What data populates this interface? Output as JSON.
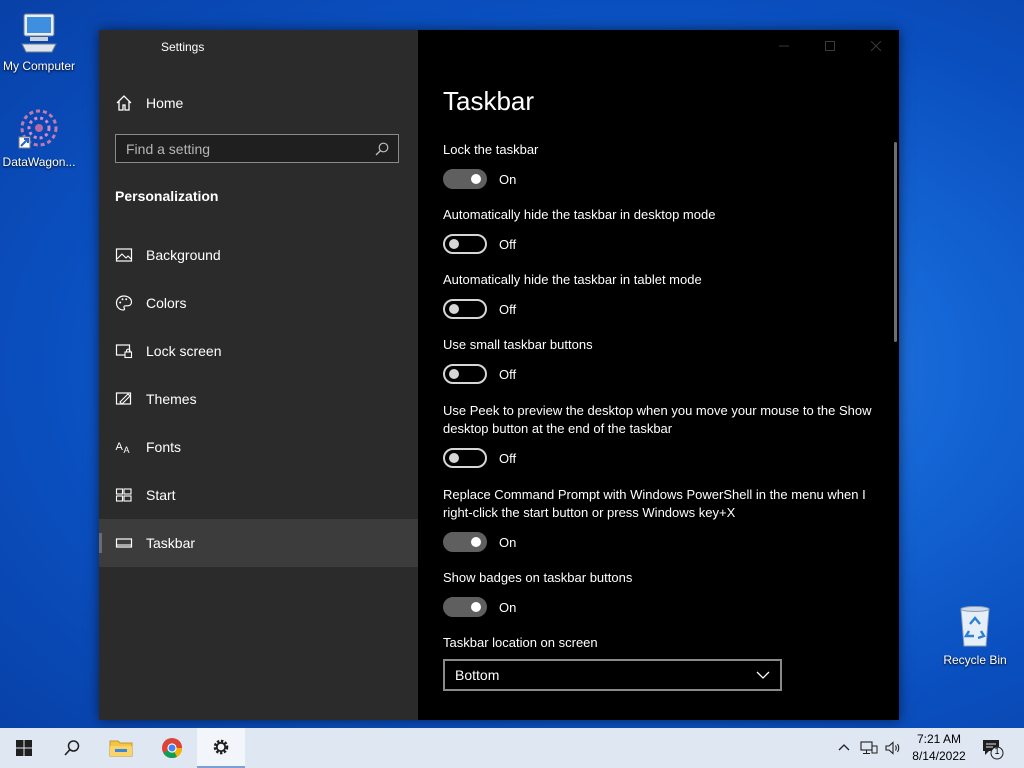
{
  "desktop": {
    "icons": [
      {
        "label": "My Computer",
        "icon": "computer-icon"
      },
      {
        "label": "DataWagon...",
        "icon": "datawagon-shortcut-icon"
      },
      {
        "label": "Recycle Bin",
        "icon": "recycle-bin-icon"
      }
    ]
  },
  "window": {
    "title": "Settings",
    "sidebar": {
      "home_label": "Home",
      "search_placeholder": "Find a setting",
      "section_heading": "Personalization",
      "items": [
        {
          "label": "Background",
          "icon": "picture-icon"
        },
        {
          "label": "Colors",
          "icon": "palette-icon"
        },
        {
          "label": "Lock screen",
          "icon": "lock-screen-icon"
        },
        {
          "label": "Themes",
          "icon": "themes-icon"
        },
        {
          "label": "Fonts",
          "icon": "fonts-icon"
        },
        {
          "label": "Start",
          "icon": "start-icon"
        },
        {
          "label": "Taskbar",
          "icon": "taskbar-icon",
          "selected": true
        }
      ]
    },
    "main": {
      "title": "Taskbar",
      "settings": [
        {
          "label": "Lock the taskbar",
          "state": "On",
          "on": true
        },
        {
          "label": "Automatically hide the taskbar in desktop mode",
          "state": "Off",
          "on": false
        },
        {
          "label": "Automatically hide the taskbar in tablet mode",
          "state": "Off",
          "on": false
        },
        {
          "label": "Use small taskbar buttons",
          "state": "Off",
          "on": false
        },
        {
          "label": "Use Peek to preview the desktop when you move your mouse to the Show desktop button at the end of the taskbar",
          "state": "Off",
          "on": false
        },
        {
          "label": "Replace Command Prompt with Windows PowerShell in the menu when I right-click the start button or press Windows key+X",
          "state": "On",
          "on": true
        },
        {
          "label": "Show badges on taskbar buttons",
          "state": "On",
          "on": true
        }
      ],
      "location_label": "Taskbar location on screen",
      "location_value": "Bottom"
    }
  },
  "taskbar": {
    "time": "7:21 AM",
    "date": "8/14/2022",
    "notification_count": "1",
    "apps": [
      "start-button",
      "search-button",
      "file-explorer",
      "chrome",
      "settings"
    ]
  },
  "colors": {
    "accent_desktop": "#1566d6",
    "window_bg": "#000000",
    "sidebar_bg": "#2b2b2b",
    "taskbar_bg": "#dfe7f2"
  }
}
